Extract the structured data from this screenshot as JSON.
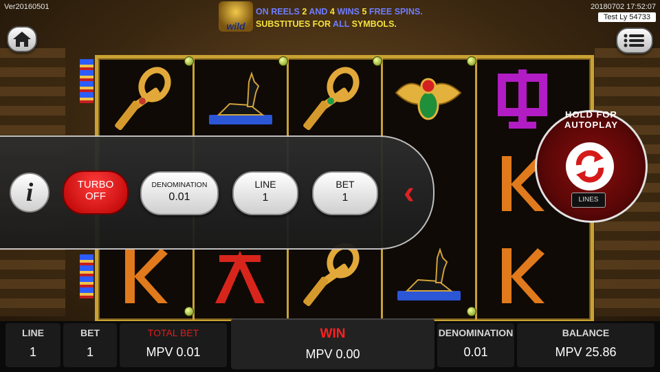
{
  "version": "Ver20160501",
  "timestamp": "20180702 17:52:07",
  "user": "Test Ly 54733",
  "banner": {
    "wild_label": "wild",
    "line1_a": "ON REELS ",
    "line1_b": "2",
    "line1_c": " AND ",
    "line1_d": "4",
    "line1_e": " WINS ",
    "line1_f": "5",
    "line1_g": " FREE SPINS.",
    "line2_a": "SUBSTITUES FOR ",
    "line2_b": "ALL",
    "line2_c": " SYMBOLS."
  },
  "icons": {
    "home": "home-icon",
    "menu": "hamburger-menu-icon",
    "info": "info-icon",
    "autoplay": "refresh-icon",
    "collapse": "chevron-left-icon"
  },
  "reels": [
    [
      "ankh",
      "ankh",
      "Q",
      "K",
      "K"
    ],
    [
      "anubis",
      "anubis",
      "K",
      "A",
      "K"
    ],
    [
      "ankh",
      "ankh",
      "scarab",
      "anubis",
      "K"
    ]
  ],
  "controls": {
    "turbo_label": "TURBO",
    "turbo_state": "OFF",
    "denomination_label": "DENOMINATION",
    "denomination_value": "0.01",
    "line_label": "LINE",
    "line_value": "1",
    "bet_label": "BET",
    "bet_value": "1",
    "info_glyph": "i",
    "collapse_glyph": "‹"
  },
  "autoplay": {
    "hold_label": "HOLD FOR AUTOPLAY",
    "lines_label": "LINES"
  },
  "status_bar": {
    "line_label": "LINE",
    "line_value": "1",
    "bet_label": "BET",
    "bet_value": "1",
    "total_bet_label": "TOTAL BET",
    "total_bet_value": "MPV 0.01",
    "win_label": "WIN",
    "win_value": "MPV 0.00",
    "denomination_label": "DENOMINATION",
    "denomination_value": "0.01",
    "balance_label": "BALANCE",
    "balance_value": "MPV 25.86"
  },
  "colors": {
    "frame_gold": "#c9a233",
    "turbo_red": "#b80000",
    "win_red": "#ff2020",
    "banner_yellow": "#f6e23c",
    "banner_blue": "#6f7dff"
  }
}
